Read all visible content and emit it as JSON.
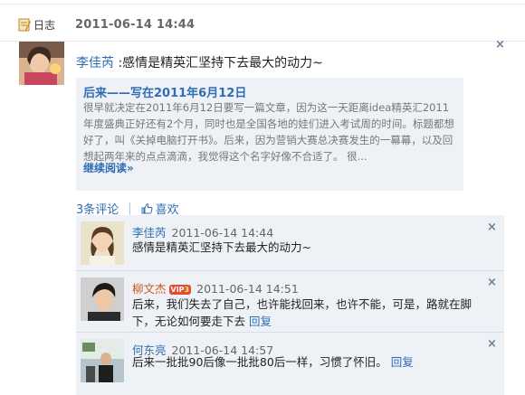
{
  "header": {
    "type_label": "日志",
    "timestamp": "2011-06-14 14:44"
  },
  "post": {
    "author": "李佳芮",
    "colon": " :",
    "status": "感情是精英汇坚持下去最大的动力~",
    "quote": {
      "title": "后来——写在2011年6月12日",
      "body": "很早就决定在2011年6月12日要写一篇文章，因为这一天距离idea精英汇2011年度盛典正好还有2个月，同时也是全国各地的娃们进入考试周的时间。标题都想好了，叫《关掉电脑打开书》。后来，因为营销大赛总决赛发生的一幕幕，以及回想起两年来的点点滴滴，我觉得这个名字好像不合适了。 很...",
      "read_more": "继续阅读»"
    }
  },
  "actions": {
    "comments": "3条评论",
    "like": "喜欢"
  },
  "comments": [
    {
      "name": "李佳芮",
      "time": "2011-06-14 14:44",
      "text": "感情是精英汇坚持下去最大的动力~",
      "reply": ""
    },
    {
      "name": "柳文杰",
      "badge": "VIP",
      "badge_level": "3",
      "time": "2011-06-14 14:51",
      "text": "后来，我们失去了自己，也许能找回来，也许不能，可是，路就在脚下，无论如何要走下去",
      "reply": "回复"
    },
    {
      "name": "何东亮",
      "time": "2011-06-14 14:57",
      "text": "后来一批批90后像一批批80后一样，习惯了怀旧。",
      "reply": "回复"
    }
  ],
  "close_glyph": "×"
}
